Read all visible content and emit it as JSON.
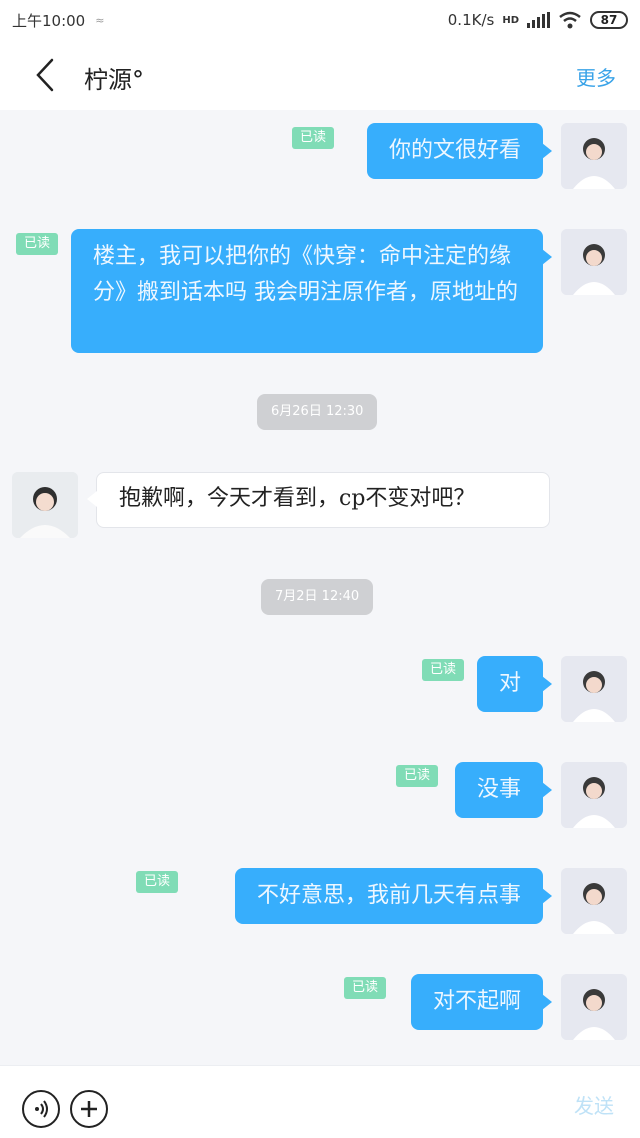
{
  "status_bar": {
    "time": "上午10:00",
    "network_speed": "0.1K/s",
    "network_type": "HD",
    "battery": "87"
  },
  "header": {
    "title": "柠源°",
    "more_label": "更多",
    "back_icon": "chevron-left-icon"
  },
  "messages": [
    {
      "direction": "out",
      "text": "你的文很好看",
      "status": "已读"
    },
    {
      "direction": "out",
      "text": "楼主，我可以把你的《快穿：命中注定的缘分》搬到话本吗 我会明注原作者，原地址的",
      "status": "已读"
    },
    {
      "type": "time",
      "text": "6月26日 12:30"
    },
    {
      "direction": "in",
      "text": "抱歉啊，今天才看到，cp不变对吧？"
    },
    {
      "type": "time",
      "text": "7月2日 12:40"
    },
    {
      "direction": "out",
      "text": "对",
      "status": "已读"
    },
    {
      "direction": "out",
      "text": "没事",
      "status": "已读"
    },
    {
      "direction": "out",
      "text": "不好意思，我前几天有点事",
      "status": "已读"
    },
    {
      "direction": "out",
      "text": "对不起啊",
      "status": "已读"
    }
  ],
  "input_bar": {
    "voice_icon": "voice-icon",
    "plus_icon": "plus-icon",
    "send_label": "发送"
  },
  "colors": {
    "bubble_out": "#37aefc",
    "read_badge": "#80dcb6",
    "accent": "#3aa3e8"
  }
}
